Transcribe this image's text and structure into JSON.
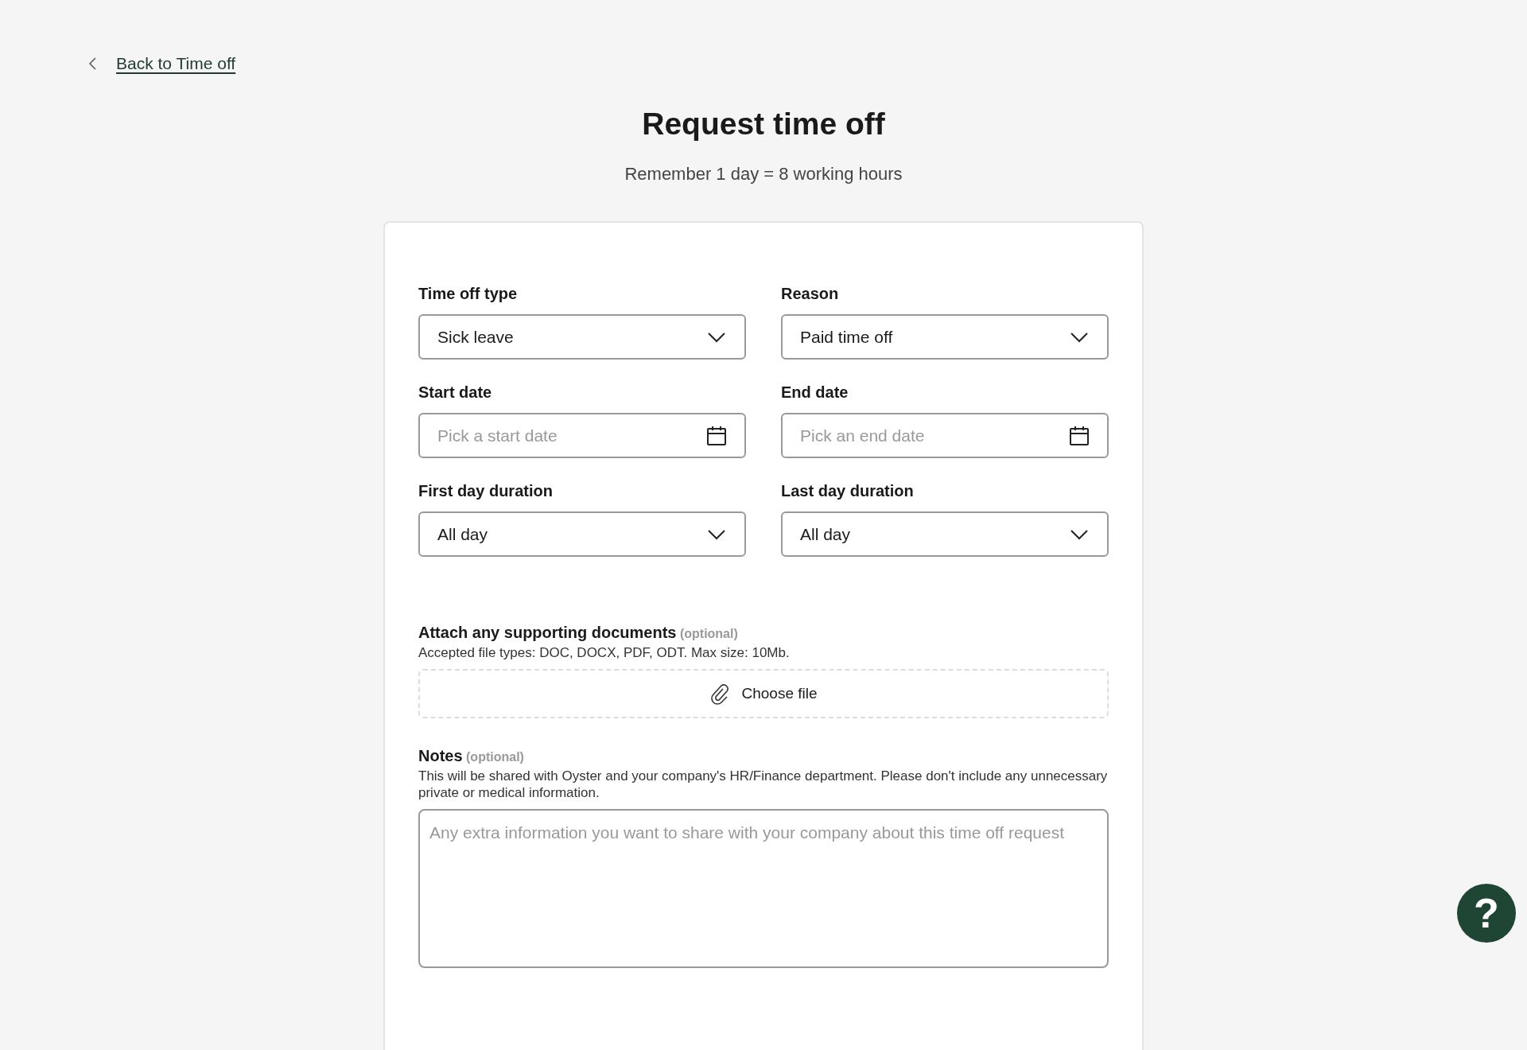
{
  "back_link": {
    "label": "Back to Time off"
  },
  "title": "Request time off",
  "subtitle": "Remember 1 day = 8 working hours",
  "fields": [
    {
      "label": "Time off type",
      "kind": "select",
      "value": "Sick leave"
    },
    {
      "label": "Reason",
      "kind": "select",
      "value": "Paid time off"
    },
    {
      "label": "Start date",
      "kind": "date",
      "placeholder": "Pick a start date"
    },
    {
      "label": "End date",
      "kind": "date",
      "placeholder": "Pick an end date"
    },
    {
      "label": "First day duration",
      "kind": "select",
      "value": "All day"
    },
    {
      "label": "Last day duration",
      "kind": "select",
      "value": "All day"
    }
  ],
  "attachments": {
    "label": "Attach any supporting documents",
    "optional": "(optional)",
    "help": "Accepted file types: DOC, DOCX, PDF, ODT. Max size: 10Mb.",
    "button": "Choose file"
  },
  "notes": {
    "label": "Notes",
    "optional": "(optional)",
    "help": "This will be shared with Oyster and your company's HR/Finance department. Please don't include any unnecessary private or medical information.",
    "placeholder": "Any extra information you want to share with your company about this time off request"
  },
  "help_button": {
    "label": "?"
  }
}
